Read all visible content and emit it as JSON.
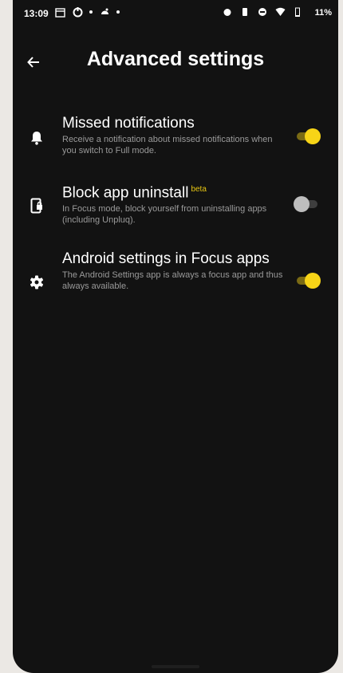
{
  "status_bar": {
    "time": "13:09",
    "battery": "11%",
    "left_icons": [
      "calendar-icon",
      "sync-icon",
      "notification-dot-icon",
      "android-icon",
      "notification-dot-icon"
    ],
    "right_icons": [
      "alarm-icon",
      "vibrate-icon",
      "dnd-icon",
      "wifi-icon",
      "battery-icon"
    ]
  },
  "header": {
    "title": "Advanced settings",
    "back_icon": "arrow-left-icon"
  },
  "settings": [
    {
      "icon": "bell-icon",
      "title": "Missed notifications",
      "badge": "",
      "description": "Receive a notification about missed notifications when you switch to Full mode.",
      "enabled": true
    },
    {
      "icon": "phone-lock-icon",
      "title": "Block app uninstall",
      "badge": "beta",
      "description": "In Focus mode, block yourself from uninstalling apps (including Unpluq).",
      "enabled": false
    },
    {
      "icon": "gear-icon",
      "title": "Android settings in Focus apps",
      "badge": "",
      "description": "The Android Settings app is always a focus app and thus always available.",
      "enabled": true
    }
  ],
  "colors": {
    "background": "#121212",
    "accent": "#f7d417",
    "text_primary": "#ffffff",
    "text_secondary": "#9a9a9a"
  }
}
